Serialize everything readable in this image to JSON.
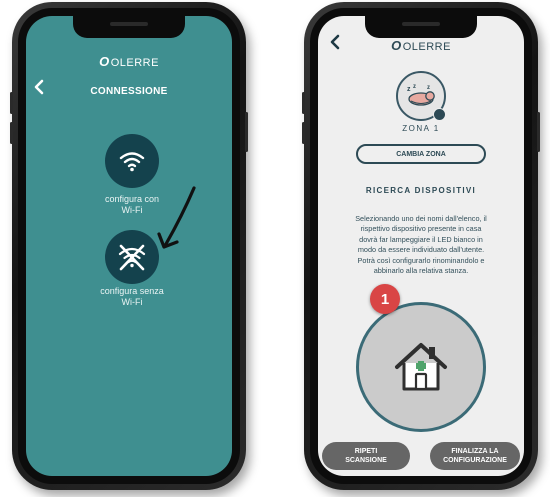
{
  "left_screen": {
    "logo_mark": "O",
    "logo_text": "OLERRE",
    "back_icon": "chevron-left-icon",
    "title": "CONNESSIONE",
    "wifi_option": {
      "icon": "wifi-icon",
      "label_line1": "configura con",
      "label_line2": "Wi-Fi"
    },
    "no_wifi_option": {
      "icon": "wifi-off-icon",
      "label_line1": "configura senza",
      "label_line2": "Wi-Fi"
    },
    "annotation_icon": "arrow-pointer-icon"
  },
  "right_screen": {
    "logo_mark": "O",
    "logo_text": "OLERRE",
    "back_icon": "chevron-left-icon",
    "zone_icon": "sleeping-zone-icon",
    "zone_label": "ZONA 1",
    "change_zone_button": "CAMBIA ZONA",
    "section_title": "RICERCA DISPOSITIVI",
    "description_lines": [
      "Selezionando uno dei nomi dall'elenco, il",
      "rispettivo dispositivo presente in casa",
      "dovrà far lampeggiare il LED bianco in",
      "modo da essere individuato dall'utente.",
      "Potrà così configurarlo rinominandolo  e",
      "abbinarlo alla relativa stanza."
    ],
    "device_count": "1",
    "device_icon": "house-icon",
    "rescan_button": {
      "line1": "RIPETI",
      "line2": "SCANSIONE"
    },
    "finalize_button": {
      "line1": "FINALIZZA LA",
      "line2": "CONFIGURAZIONE"
    }
  },
  "colors": {
    "teal_background": "#3f8f90",
    "dark_teal": "#14424d",
    "light_background": "#efefef",
    "badge_red": "#d94545",
    "button_grey": "#666666"
  }
}
